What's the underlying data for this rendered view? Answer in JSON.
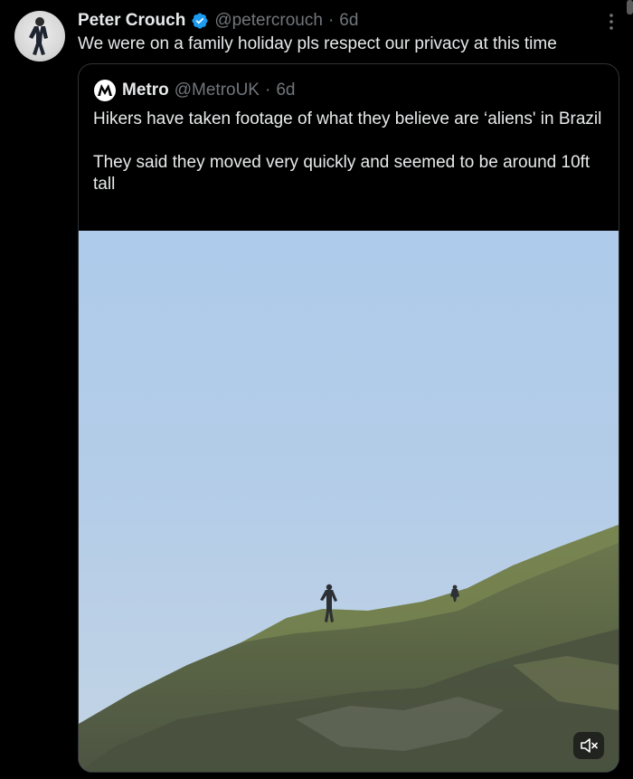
{
  "tweet": {
    "author_name": "Peter Crouch",
    "author_handle": "@petercrouch",
    "separator": "·",
    "time": "6d",
    "text": "We were on a family holiday pls respect our privacy at this time"
  },
  "quoted_tweet": {
    "author_name": "Metro",
    "author_handle": "@MetroUK",
    "separator": "·",
    "time": "6d",
    "paragraphs": [
      "Hikers have taken footage of what they believe are ‘aliens' in Brazil",
      "They said they moved very quickly and seemed to be around 10ft tall"
    ]
  },
  "media": {
    "type": "video",
    "mute_icon": "speaker-muted-icon"
  },
  "colors": {
    "background": "#000000",
    "text_primary": "#e7e9ea",
    "text_secondary": "#71767b",
    "verified": "#1d9bf0",
    "border": "#2f3336"
  }
}
